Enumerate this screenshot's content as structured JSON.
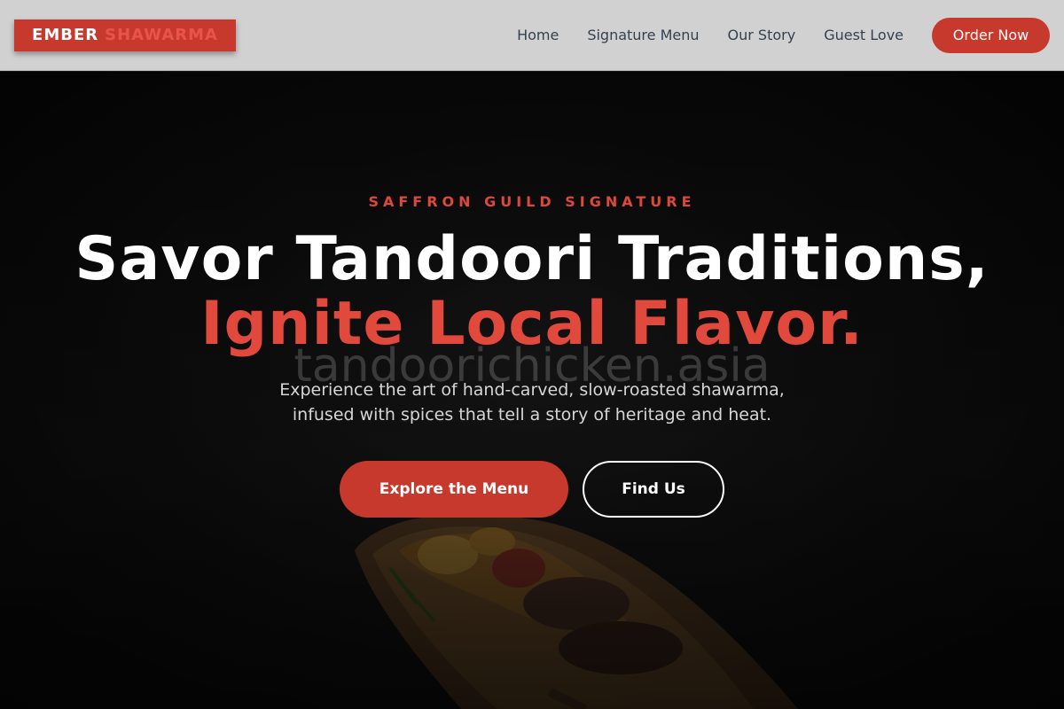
{
  "brand": {
    "word1": "EMBER",
    "word2": "SHAWARMA"
  },
  "nav": {
    "links": [
      "Home",
      "Signature Menu",
      "Our Story",
      "Guest Love"
    ],
    "cta": "Order Now"
  },
  "hero": {
    "eyebrow": "SAFFRON GUILD SIGNATURE",
    "headline_line1": "Savor Tandoori Traditions,",
    "headline_line2": "Ignite Local Flavor.",
    "watermark": "tandoorichicken.asia",
    "description_line1": "Experience the art of hand-carved, slow-roasted shawarma,",
    "description_line2": "infused with spices that tell a story of heritage and heat.",
    "primary_button": "Explore the Menu",
    "secondary_button": "Find Us"
  },
  "colors": {
    "accent": "#c8392d",
    "accent_text": "#e2493d",
    "nav_bg": "#d1d1d1",
    "hero_bg": "#151515"
  }
}
